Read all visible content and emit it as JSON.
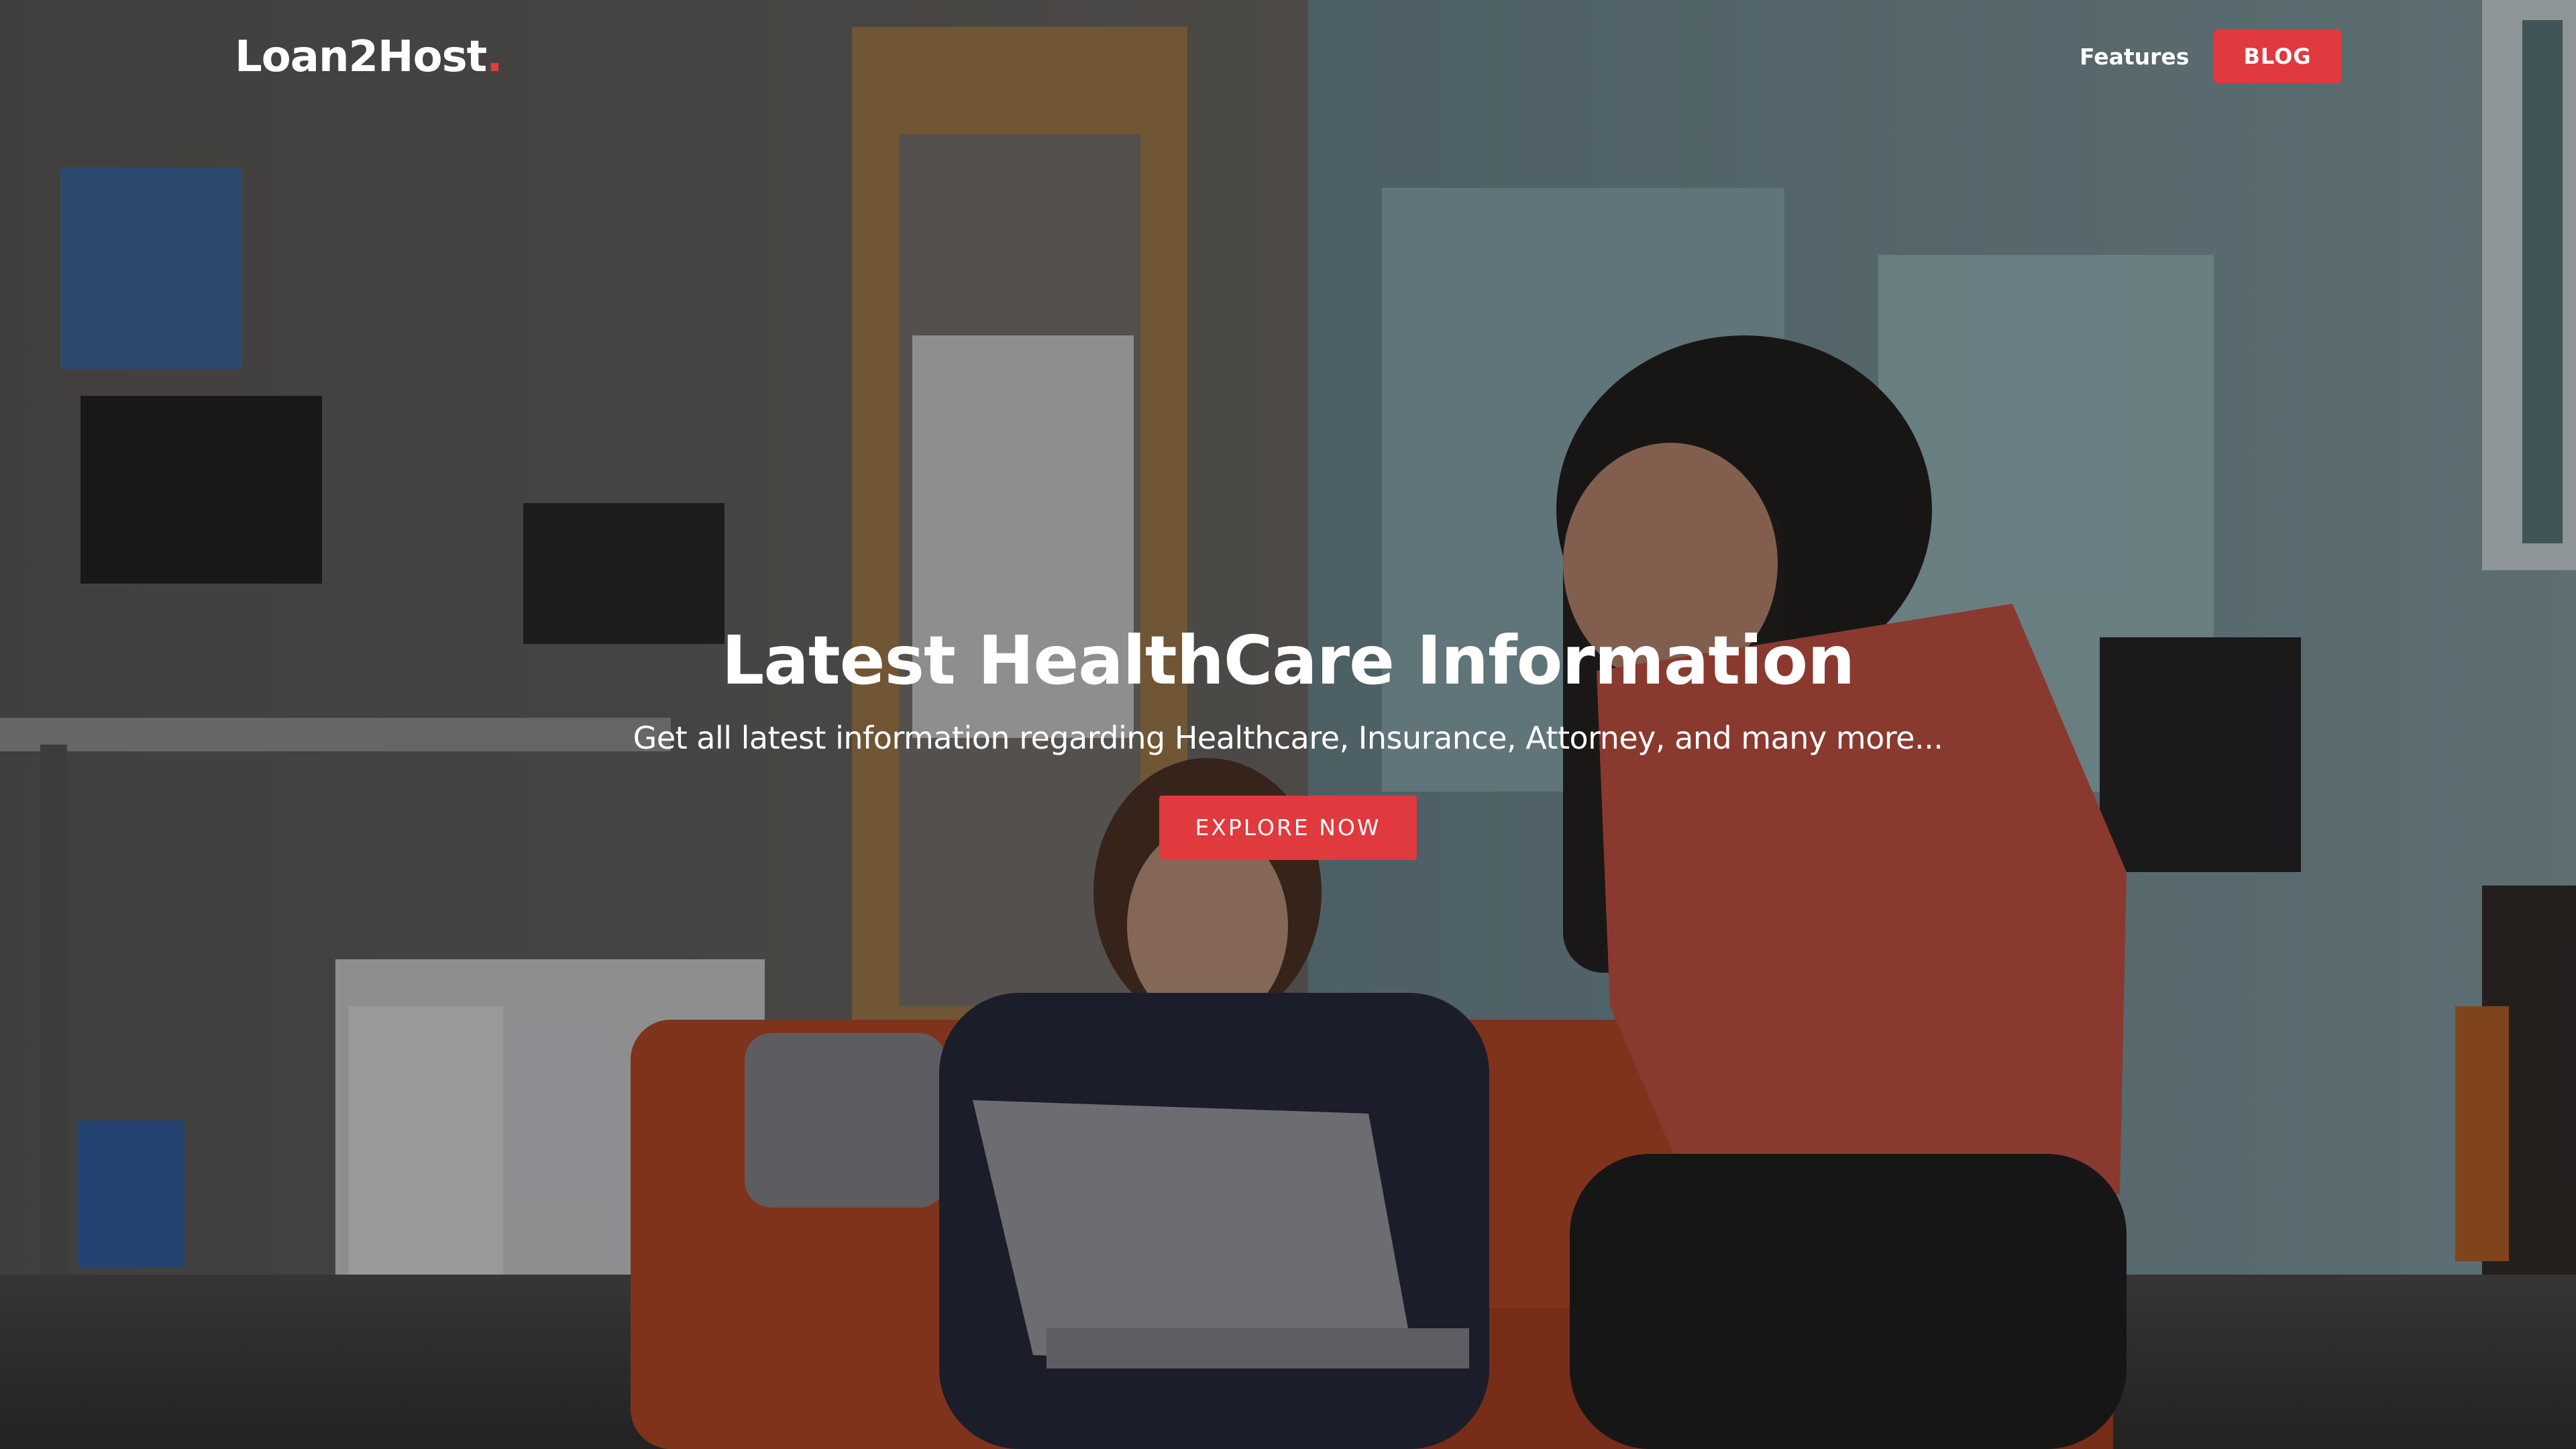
{
  "brand": {
    "name": "Loan2Host",
    "dot": "."
  },
  "nav": {
    "features_label": "Features",
    "blog_label": "BLOG"
  },
  "hero": {
    "title": "Latest HealthCare Information",
    "subtitle": "Get all latest information regarding Healthcare, Insurance, Attorney, and many more...",
    "cta_label": "EXPLORE NOW"
  },
  "colors": {
    "accent": "#e0393e",
    "text": "#ffffff",
    "overlay": "#141416"
  }
}
